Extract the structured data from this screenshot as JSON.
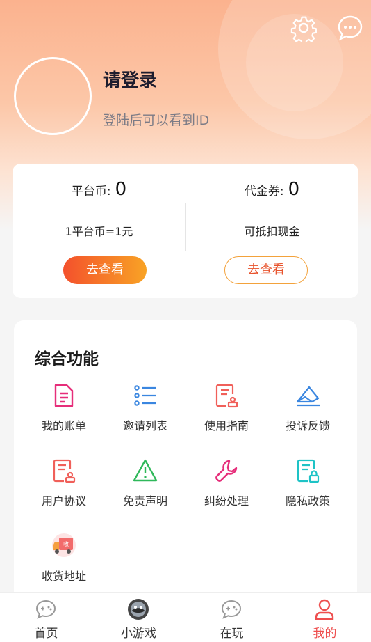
{
  "header": {
    "login_title": "请登录",
    "login_sub": "登陆后可以看到ID",
    "icons": [
      "gear-icon",
      "chat-bubble-icon"
    ]
  },
  "wallet": {
    "platform_coin_label": "平台币:",
    "platform_coin_value": "0",
    "platform_coin_desc": "1平台币=1元",
    "platform_coin_button": "去查看",
    "voucher_label": "代金券:",
    "voucher_value": "0",
    "voucher_desc": "可抵扣现金",
    "voucher_button": "去查看"
  },
  "features": {
    "title": "综合功能",
    "items": [
      {
        "label": "我的账单",
        "icon": "bill-icon"
      },
      {
        "label": "邀请列表",
        "icon": "list-icon"
      },
      {
        "label": "使用指南",
        "icon": "guide-icon"
      },
      {
        "label": "投诉反馈",
        "icon": "feedback-icon"
      },
      {
        "label": "用户协议",
        "icon": "agreement-icon"
      },
      {
        "label": "免责声明",
        "icon": "warning-icon"
      },
      {
        "label": "纠纷处理",
        "icon": "wrench-icon"
      },
      {
        "label": "隐私政策",
        "icon": "privacy-icon"
      },
      {
        "label": "收货地址",
        "icon": "delivery-truck-icon"
      }
    ]
  },
  "tabbar": {
    "items": [
      {
        "label": "首页",
        "icon": "gamepad-icon"
      },
      {
        "label": "小游戏",
        "icon": "minigame-icon"
      },
      {
        "label": "在玩",
        "icon": "gamepad-icon"
      },
      {
        "label": "我的",
        "icon": "user-icon"
      }
    ],
    "active_index": 3
  },
  "colors": {
    "accent": "#ee4f4f",
    "gradient_start": "#f4512c",
    "gradient_end": "#f8a325"
  }
}
